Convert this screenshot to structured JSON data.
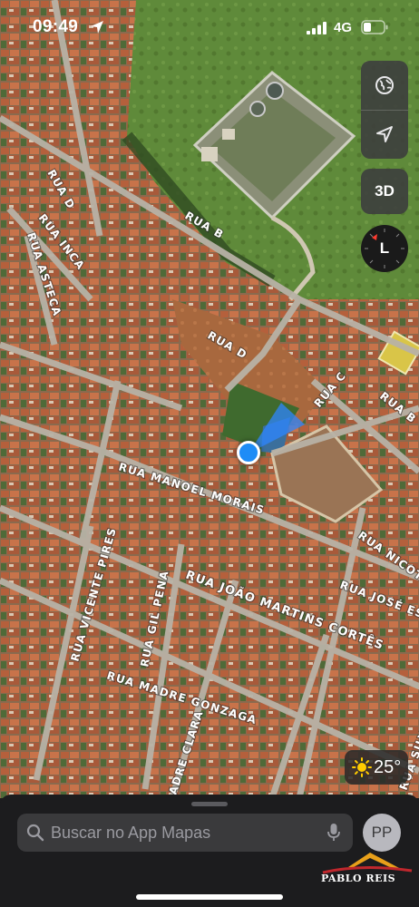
{
  "status_bar": {
    "time": "09:49",
    "network": "4G",
    "location_icon": "location-arrow-icon",
    "signal_icon": "cellular-signal-icon",
    "battery_icon": "battery-icon"
  },
  "map": {
    "type": "satellite",
    "street_labels": [
      "RUA D",
      "RUA INCA",
      "RUA ASTECA",
      "RUA B",
      "RUA D",
      "RUA C",
      "RUA B",
      "RUA MANOEL MORAIS",
      "RUA NICOTA",
      "RUA JOÃO MARTINS CORTÊS",
      "RUA JOSÉ ESP",
      "RUA VICENTE PIRES",
      "RUA GIL PENA",
      "RUA MADRE GONZAGA",
      "ADRE CLARA",
      "RUA SILV"
    ],
    "user_location_icon": "user-location-dot",
    "colors": {
      "user_dot": "#1e8cf6",
      "heading_cone": "#2f86ff"
    }
  },
  "controls": {
    "map_mode_icon": "globe-icon",
    "tracking_icon": "location-arrow-icon",
    "view_3d_label": "3D",
    "compass_letter": "L",
    "compass_icon": "compass-icon"
  },
  "weather": {
    "icon": "sun-icon",
    "temperature": "25°"
  },
  "bottom_sheet": {
    "search_placeholder": "Buscar no App Mapas",
    "search_icon": "magnifier-icon",
    "mic_icon": "microphone-icon",
    "avatar_initials": "PP"
  },
  "watermark": {
    "text": "PABLO REIS"
  }
}
